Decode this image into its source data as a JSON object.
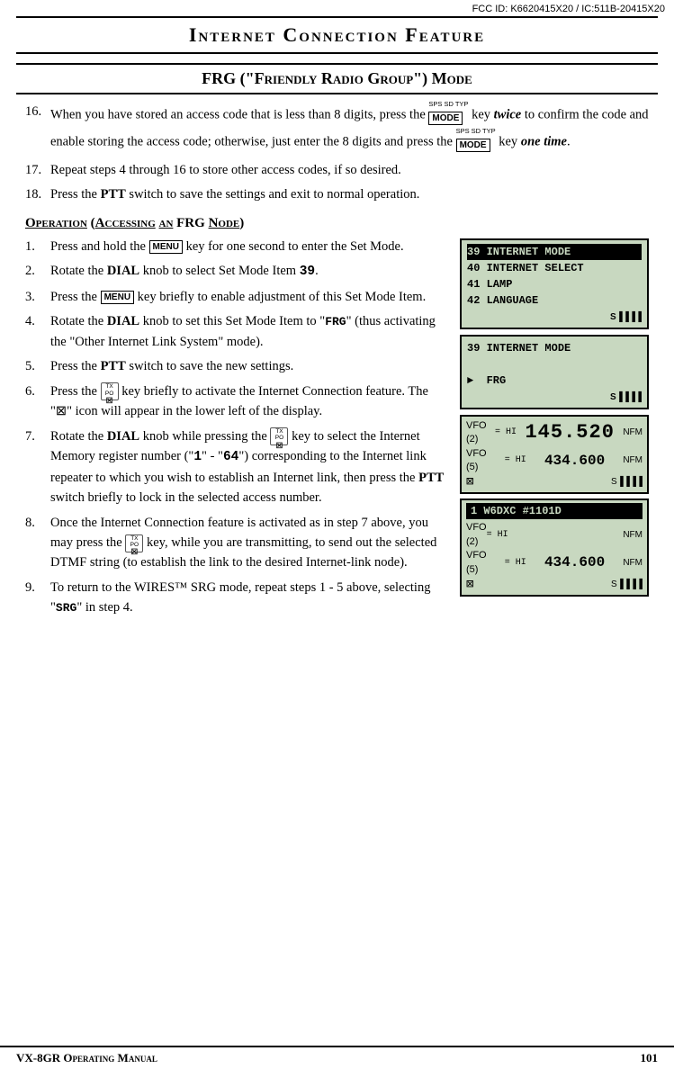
{
  "fcc_id": "FCC ID: K6620415X20 / IC:511B-20415X20",
  "page_title": "Internet Connection Feature",
  "section_title": "FRG (\"Friendly Radio Group\") Mode",
  "intro_items": [
    {
      "num": "16.",
      "text": "When you have stored an access code that is less than 8 digits, press the",
      "key_label": "MODE",
      "key_sup": "SPS SD TYP",
      "cont": "key ",
      "bold_italic": "twice",
      "cont2": " to confirm the code and enable storing the access code; otherwise, just enter the 8 digits and press the",
      "key_label2": "MODE",
      "key_sup2": "SPS SD TYP",
      "cont3": "key ",
      "bold_italic2": "one time",
      "cont4": "."
    },
    {
      "num": "17.",
      "text": "Repeat steps 4 through 16 to store other access codes, if so desired."
    },
    {
      "num": "18.",
      "text": "Press the PTT switch to save the settings and exit to normal operation."
    }
  ],
  "sub_section": "Operation (Accessing an FRG Node)",
  "op_items": [
    {
      "num": "1.",
      "text": "Press and hold the",
      "key": "MENU",
      "cont": "key for one second to enter the Set Mode."
    },
    {
      "num": "2.",
      "text": "Rotate the DIAL knob to select Set Mode Item",
      "bold_end": "39",
      "cont": "."
    },
    {
      "num": "3.",
      "text": "Press the",
      "key": "MENU",
      "cont": "key briefly to enable adjustment of this Set Mode Item."
    },
    {
      "num": "4.",
      "text": "Rotate the DIAL knob to set this Set Mode Item to \"FRG\" (thus activating the \"Other Internet Link System\" mode)."
    },
    {
      "num": "5.",
      "text": "Press the PTT switch to save the new settings."
    },
    {
      "num": "6.",
      "text": "Press the",
      "key": "TXPO",
      "cont": "key briefly to activate the Internet Connection feature. The \"☒\" icon will appear in the lower left of the display."
    },
    {
      "num": "7.",
      "text": "Rotate the DIAL knob while pressing the",
      "key": "TXPO",
      "cont": "key to select the Internet Memory register number (\"1\" - \"64\") corresponding to the Internet link repeater to which you wish to establish an Internet link, then press the PTT switch briefly to lock in the selected access number."
    },
    {
      "num": "8.",
      "text": "Once the Internet Connection feature is activated as in step 7 above, you may press the",
      "key": "TXPO",
      "cont": "key, while you are transmitting, to send out the selected DTMF string (to establish the link to the desired Internet-link node)."
    },
    {
      "num": "9.",
      "text": "To return to the WIRES™ SRG mode, repeat steps 1 - 5 above, selecting \"SRG\" in step 4."
    }
  ],
  "screens": {
    "screen1": {
      "lines": [
        "39 INTERNET MODE",
        "40 INTERNET SELECT",
        "41 LAMP",
        "42 LANGUAGE"
      ],
      "highlighted": 0,
      "signal": "S▐▐▐▐"
    },
    "screen2": {
      "lines": [
        "39 INTERNET MODE",
        "",
        "► FRG"
      ],
      "signal": "S▐▐▐▐"
    },
    "screen3": {
      "vfo_top_label": "VFO",
      "vfo_top_num": "(2)",
      "freq_top": "145.520",
      "mode_top": "NFM",
      "hi_top": "= HI",
      "vfo_bot_label": "VFO",
      "vfo_bot_num": "(5)",
      "freq_bot": "434.600",
      "mode_bot": "NFM",
      "hi_bot": "= HI",
      "signal": "S▐▐▐▐"
    },
    "screen4": {
      "callsign": "1  W6DXC    #1101D",
      "vfo_top_label": "VFO",
      "vfo_top_num": "(2)",
      "hi_top": "= HI",
      "mode_top": "NFM",
      "freq_bot": "434.600",
      "vfo_bot_label": "VFO",
      "vfo_bot_num": "(5)",
      "hi_bot": "= HI",
      "mode_bot": "NFM",
      "signal": "S▐▐▐▐"
    }
  },
  "footer": {
    "left": "VX-8GR Operating Manual",
    "right": "101"
  }
}
